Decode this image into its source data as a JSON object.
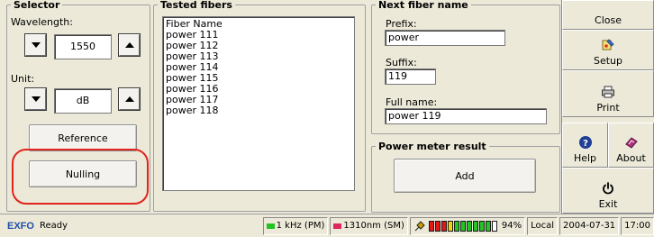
{
  "selector": {
    "legend": "Selector",
    "wavelength_label": "Wavelength:",
    "wavelength_value": "1550",
    "unit_label": "Unit:",
    "unit_value": "dB",
    "reference_button": "Reference",
    "nulling_button": "Nulling"
  },
  "tested_fibers": {
    "legend": "Tested fibers",
    "column_header": "Fiber Name",
    "items": [
      "power 111",
      "power 112",
      "power 113",
      "power 114",
      "power 115",
      "power 116",
      "power 117",
      "power 118"
    ]
  },
  "next_fiber_name": {
    "legend": "Next fiber name",
    "prefix_label": "Prefix:",
    "prefix_value": "power",
    "suffix_label": "Suffix:",
    "suffix_value": "119",
    "fullname_label": "Full name:",
    "fullname_value": "power 119"
  },
  "power_meter": {
    "legend": "Power meter result",
    "add_button": "Add"
  },
  "toolbar": {
    "close": "Close",
    "setup": "Setup",
    "print": "Print",
    "help": "Help",
    "about": "About",
    "exit": "Exit"
  },
  "status": {
    "brand": "EXFO",
    "state": "Ready",
    "modulation": "1 kHz (PM)",
    "source": "1310nm (SM)",
    "battery_percent": "94%",
    "mode": "Local",
    "date": "2004-07-31",
    "time": "17:00"
  },
  "colors": {
    "highlight_ring": "#e0241e",
    "modulation_indicator": "#22c422",
    "source_indicator": "#e0245e",
    "battery_red": "#e01818",
    "battery_yellow": "#f2d20a",
    "battery_green": "#22c422",
    "brand_blue": "#1f4fa8"
  },
  "battery_level": 0.94,
  "icons": {
    "setup": "setup-icon",
    "print": "printer-icon",
    "help": "help-icon",
    "about": "about-icon",
    "exit": "power-icon",
    "status_link": "probe-icon"
  }
}
